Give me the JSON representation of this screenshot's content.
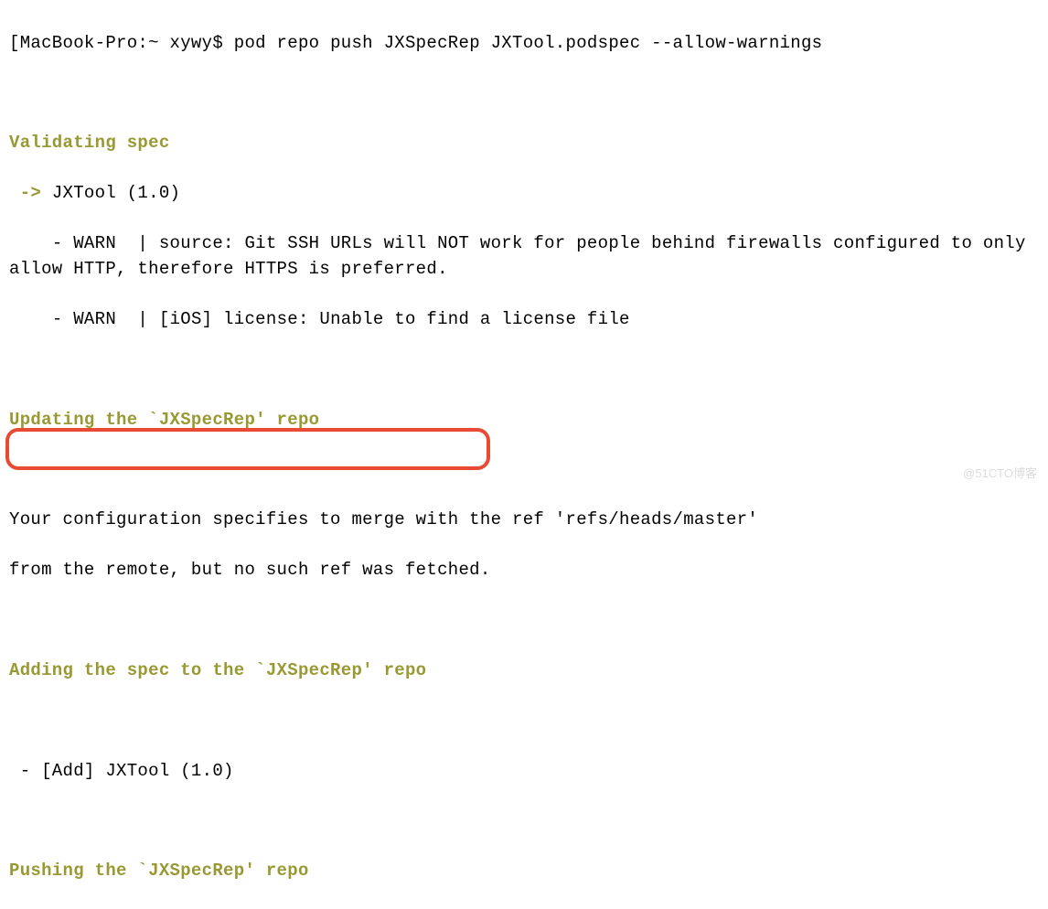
{
  "prompt": {
    "open_bracket": "[",
    "host": "MacBook-Pro:~ xywy$",
    "command": " pod repo push JXSpecRep JXTool.podspec --allow-warnings",
    "close_bracket": "]"
  },
  "section_validating": "Validating spec",
  "arrow": " -> ",
  "spec_version": "JXTool (1.0)",
  "warn1_prefix": "    - WARN  | ",
  "warn1_text": "source: Git SSH URLs will NOT work for people behind firewalls configured to only allow HTTP, therefore HTTPS is preferred.",
  "warn2_prefix": "    - WARN  | ",
  "warn2_text": "[iOS] license: Unable to find a license file",
  "section_updating": "Updating the `JXSpecRep' repo",
  "merge_line1": "Your configuration specifies to merge with the ref 'refs/heads/master'",
  "merge_line2": "from the remote, but no such ref was fetched.",
  "section_adding": "Adding the spec to the `JXSpecRep' repo",
  "add_item": " - [Add] JXTool (1.0)",
  "section_pushing": "Pushing the `JXSpecRep' repo",
  "watermark": "@51CTO博客"
}
